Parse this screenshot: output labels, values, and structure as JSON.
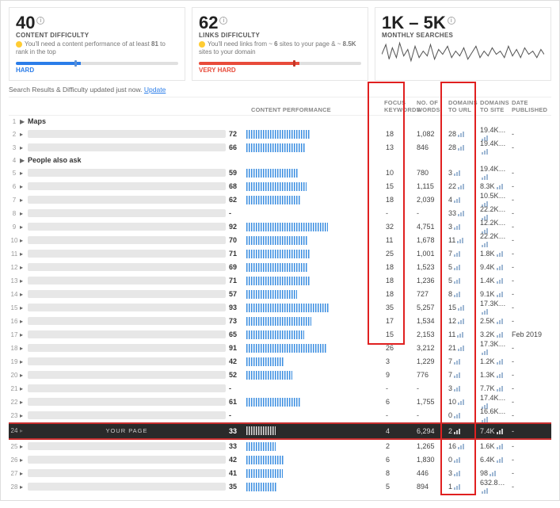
{
  "cards": {
    "content": {
      "value": "40",
      "label": "CONTENT DIFFICULTY",
      "desc_pre": "You'll need a content performance of at least ",
      "desc_bold": "81",
      "desc_post": " to rank in the top",
      "meter": "HARD"
    },
    "links": {
      "value": "62",
      "label": "LINKS DIFFICULTY",
      "desc_pre": "You'll need links from ~ ",
      "desc_b1": "6",
      "desc_mid": " sites to your page & ~ ",
      "desc_b2": "8.5K",
      "desc_post": " sites to your domain",
      "meter": "VERY HARD"
    },
    "searches": {
      "value": "1K – 5K",
      "label": "MONTHLY SEARCHES"
    }
  },
  "update": {
    "text": "Search Results & Difficulty updated just now.",
    "link": "Update"
  },
  "headers": {
    "perf": "CONTENT PERFORMANCE",
    "fk": "FOCUS KEYWORDS",
    "nw": "NO. OF WORDS",
    "du": "DOMAINS TO URL",
    "ds": "DOMAINS TO SITE",
    "dp": "DATE PUBLISHED"
  },
  "section_maps": "Maps",
  "section_paa": "People also ask",
  "your_page": "YOUR PAGE",
  "rows": [
    {
      "n": 1,
      "sep": true
    },
    {
      "n": 2,
      "cp": "72",
      "pf": 72,
      "fk": "18",
      "nw": "1,082",
      "du": "28",
      "ds": "19.4K…",
      "dp": "-"
    },
    {
      "n": 3,
      "cp": "66",
      "pf": 66,
      "fk": "13",
      "nw": "846",
      "du": "28",
      "ds": "19.4K…",
      "dp": "-"
    },
    {
      "n": 4,
      "sep": true
    },
    {
      "n": 5,
      "cp": "59",
      "pf": 59,
      "fk": "10",
      "nw": "780",
      "du": "3",
      "ds": "19.4K…",
      "dp": "-"
    },
    {
      "n": 6,
      "cp": "68",
      "pf": 68,
      "fk": "15",
      "nw": "1,115",
      "du": "22",
      "ds": "8.3K",
      "dp": "-"
    },
    {
      "n": 7,
      "cp": "62",
      "pf": 62,
      "fk": "18",
      "nw": "2,039",
      "du": "4",
      "ds": "10.5K…",
      "dp": "-"
    },
    {
      "n": 8,
      "cp": "-",
      "pf": 0,
      "fk": "-",
      "nw": "-",
      "du": "33",
      "ds": "22.2K…",
      "dp": "-"
    },
    {
      "n": 9,
      "cp": "92",
      "pf": 92,
      "fk": "32",
      "nw": "4,751",
      "du": "3",
      "ds": "12.2K…",
      "dp": "-"
    },
    {
      "n": 10,
      "cp": "70",
      "pf": 70,
      "fk": "11",
      "nw": "1,678",
      "du": "11",
      "ds": "22.2K…",
      "dp": "-"
    },
    {
      "n": 11,
      "cp": "71",
      "pf": 71,
      "fk": "25",
      "nw": "1,001",
      "du": "7",
      "ds": "1.8K",
      "dp": "-"
    },
    {
      "n": 12,
      "cp": "69",
      "pf": 69,
      "fk": "18",
      "nw": "1,523",
      "du": "5",
      "ds": "9.4K",
      "dp": "-"
    },
    {
      "n": 13,
      "cp": "71",
      "pf": 71,
      "fk": "18",
      "nw": "1,236",
      "du": "5",
      "ds": "1.4K",
      "dp": "-"
    },
    {
      "n": 14,
      "cp": "57",
      "pf": 57,
      "fk": "18",
      "nw": "727",
      "du": "8",
      "ds": "9.1K",
      "dp": "-"
    },
    {
      "n": 15,
      "cp": "93",
      "pf": 93,
      "fk": "35",
      "nw": "5,257",
      "du": "15",
      "ds": "17.3K…",
      "dp": "-"
    },
    {
      "n": 16,
      "cp": "73",
      "pf": 73,
      "fk": "17",
      "nw": "1,534",
      "du": "12",
      "ds": "2.5K",
      "dp": "-"
    },
    {
      "n": 17,
      "cp": "65",
      "pf": 65,
      "fk": "15",
      "nw": "2,153",
      "du": "11",
      "ds": "3.2K",
      "dp": "Feb 2019"
    },
    {
      "n": 18,
      "cp": "91",
      "pf": 91,
      "fk": "26",
      "nw": "3,212",
      "du": "21",
      "ds": "17.3K…",
      "dp": "-"
    },
    {
      "n": 19,
      "cp": "42",
      "pf": 42,
      "fk": "3",
      "nw": "1,229",
      "du": "7",
      "ds": "1.2K",
      "dp": "-"
    },
    {
      "n": 20,
      "cp": "52",
      "pf": 52,
      "fk": "9",
      "nw": "776",
      "du": "7",
      "ds": "1.3K",
      "dp": "-"
    },
    {
      "n": 21,
      "cp": "-",
      "pf": 0,
      "fk": "-",
      "nw": "-",
      "du": "3",
      "ds": "7.7K",
      "dp": "-"
    },
    {
      "n": 22,
      "cp": "61",
      "pf": 61,
      "fk": "6",
      "nw": "1,755",
      "du": "10",
      "ds": "17.4K…",
      "dp": "-"
    },
    {
      "n": 23,
      "cp": "-",
      "pf": 0,
      "fk": "-",
      "nw": "-",
      "du": "0",
      "ds": "16.6K…",
      "dp": "-"
    },
    {
      "n": 24,
      "cp": "33",
      "pf": 33,
      "fk": "4",
      "nw": "6,294",
      "du": "2",
      "ds": "7.4K",
      "dp": "-",
      "your": true
    },
    {
      "n": 25,
      "cp": "33",
      "pf": 33,
      "fk": "2",
      "nw": "1,265",
      "du": "16",
      "ds": "1.6K",
      "dp": "-"
    },
    {
      "n": 26,
      "cp": "42",
      "pf": 42,
      "fk": "6",
      "nw": "1,830",
      "du": "0",
      "ds": "6.4K",
      "dp": "-"
    },
    {
      "n": 27,
      "cp": "41",
      "pf": 41,
      "fk": "8",
      "nw": "446",
      "du": "3",
      "ds": "98",
      "dp": "-"
    },
    {
      "n": 28,
      "cp": "35",
      "pf": 35,
      "fk": "5",
      "nw": "894",
      "du": "1",
      "ds": "632.8…",
      "dp": "-"
    }
  ]
}
